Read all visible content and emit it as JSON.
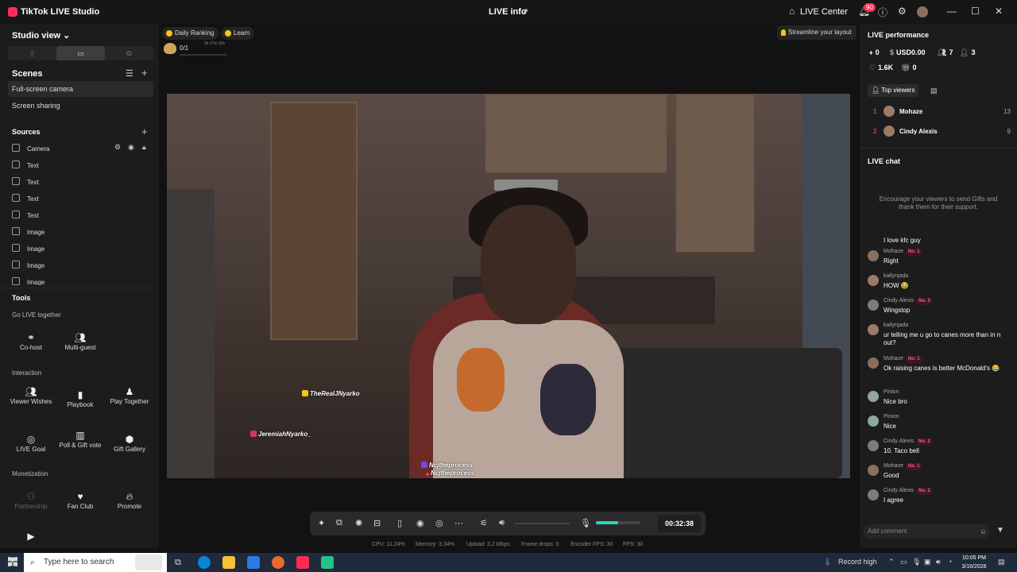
{
  "titlebar": {
    "app_name": "TikTok LIVE Studio",
    "center_title": "LIVE info",
    "live_center": "LIVE Center",
    "notifications_count": "90"
  },
  "left": {
    "studio_view": "Studio view",
    "scenes_title": "Scenes",
    "scenes": [
      "Full-screen camera",
      "Screen sharing"
    ],
    "sources_title": "Sources",
    "sources": [
      "Camera",
      "Text",
      "Text",
      "Text",
      "Text",
      "Image",
      "Image",
      "Image",
      "Image"
    ],
    "tools_title": "Tools",
    "go_live_together": "Go LIVE together",
    "cohost": "Co-host",
    "multiguest": "Multi-guest",
    "interaction": "Interaction",
    "viewer_wishes": "Viewer Wishes",
    "playbook": "Playbook",
    "play_together": "Play Together",
    "live_goal": "LIVE Goal",
    "poll_gift_vote": "Poll & Gift vote",
    "gift_gallery": "Gift Gallery",
    "monetization": "Monetization",
    "partnership": "Partnership",
    "fan_club": "Fan Club",
    "promote": "Promote"
  },
  "center": {
    "daily_ranking": "Daily Ranking",
    "learn": "Learn",
    "goal_progress": "0/1",
    "goal_time": "3h 27m 33s",
    "streamline": "Streamline your layout",
    "tags": {
      "t1": "TheRealJNyarko",
      "t2": "JeremiahNyarko_",
      "t3": "Ncjtheprocess",
      "t4": "Ncjtheprocess"
    },
    "timer": "00:32:38",
    "mic_level": 0.5,
    "stats": {
      "cpu": "CPU: 11.24%",
      "memory": "Memory: 3.34%",
      "upload": "Upload: 3.2 Mbps",
      "frame_drops": "Frame drops: 0",
      "encoder_fps": "Encoder FPS: 30",
      "fps": "FPS: 30"
    }
  },
  "right": {
    "perf_title": "LIVE performance",
    "diamonds": "0",
    "usd": "USD0.00",
    "viewers": "7",
    "new_followers": "3",
    "likes": "1.6K",
    "gifts": "0",
    "top_viewers_label": "Top viewers",
    "top_viewers": [
      {
        "rank": "1",
        "name": "Mohaze",
        "score": "13"
      },
      {
        "rank": "2",
        "name": "Cindy Alexis",
        "score": "9"
      }
    ],
    "chat_title": "LIVE chat",
    "encourage": "Encourage your viewers to send Gifts and thank them for their support.",
    "partial_msg": "I love kfc guy",
    "messages": [
      {
        "name": "Mohaze",
        "badge": "No. 1",
        "text": "Right"
      },
      {
        "name": "kailynjada",
        "badge": "",
        "text": "HOW 😂"
      },
      {
        "name": "Cindy Alexis",
        "badge": "No. 3",
        "text": "Wingstop"
      },
      {
        "name": "kailynjada",
        "badge": "",
        "text": "ur telling me u go to canes more than in n out?"
      },
      {
        "name": "Mohaze",
        "badge": "No. 1",
        "text": "Ok raising canes is better McDonald's 😂"
      },
      {
        "name": "Pinion",
        "badge": "",
        "text": "Nice bro"
      },
      {
        "name": "Pinion",
        "badge": "",
        "text": "Nice"
      },
      {
        "name": "Cindy Alexis",
        "badge": "No. 2",
        "text": "10. Taco bell"
      },
      {
        "name": "Mohaze",
        "badge": "No. 1",
        "text": "Good"
      },
      {
        "name": "Cindy Alexis",
        "badge": "No. 2",
        "text": "I agree"
      }
    ],
    "comment_placeholder": "Add comment"
  },
  "taskbar": {
    "search_placeholder": "Type here to search",
    "record": "Record high",
    "time": "10:05 PM",
    "date": "3/16/2026"
  },
  "colors": {
    "accent": "#fe2c55",
    "mic": "#2ed3b7",
    "bg": "#121212"
  }
}
